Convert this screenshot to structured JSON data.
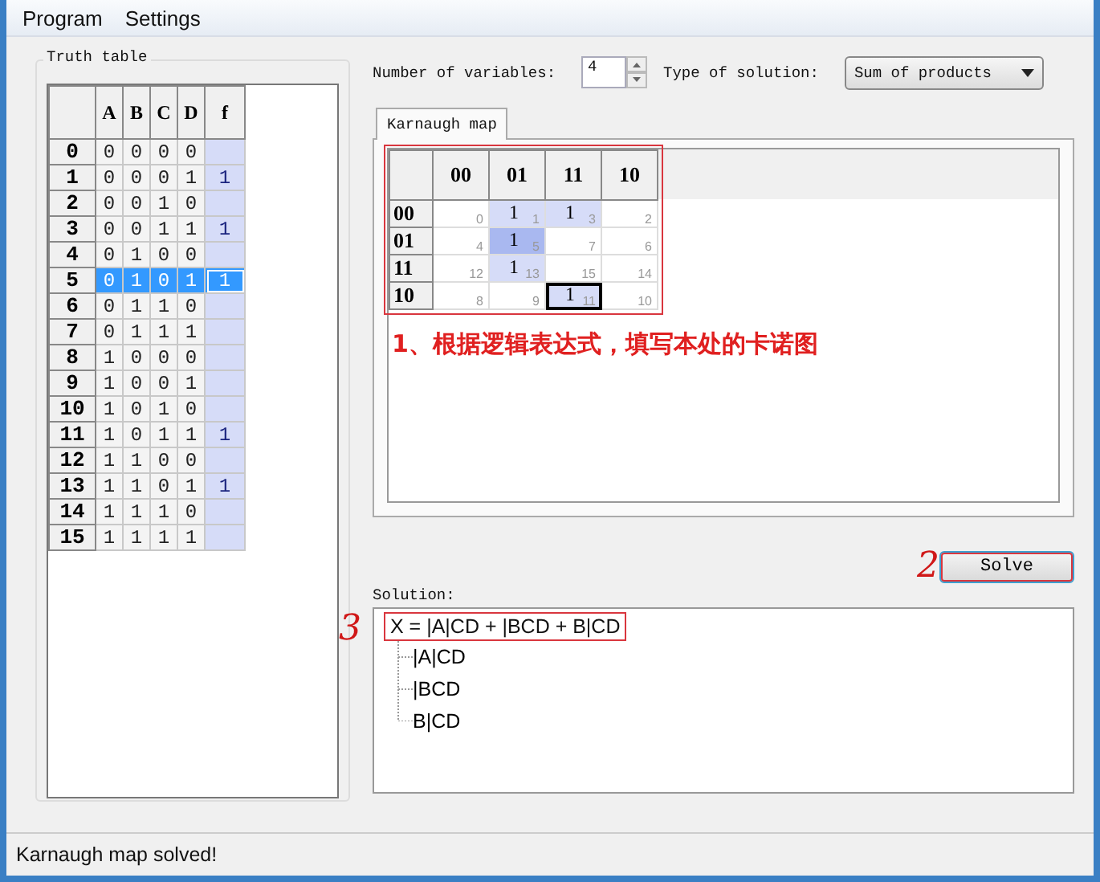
{
  "menu": [
    "Program",
    "Settings"
  ],
  "truth_table": {
    "title": "Truth table",
    "columns": [
      "A",
      "B",
      "C",
      "D",
      "f"
    ],
    "rows": [
      {
        "index": "0",
        "bits": [
          "0",
          "0",
          "0",
          "0"
        ],
        "selected": false
      },
      {
        "index": "1",
        "bits": [
          "0",
          "0",
          "0",
          "1"
        ],
        "f": "1",
        "selected": false
      },
      {
        "index": "2",
        "bits": [
          "0",
          "0",
          "1",
          "0"
        ],
        "selected": false
      },
      {
        "index": "3",
        "bits": [
          "0",
          "0",
          "1",
          "1"
        ],
        "f": "1",
        "selected": false
      },
      {
        "index": "4",
        "bits": [
          "0",
          "1",
          "0",
          "0"
        ],
        "selected": false
      },
      {
        "index": "5",
        "bits": [
          "0",
          "1",
          "0",
          "1"
        ],
        "f": "1",
        "selected": true
      },
      {
        "index": "6",
        "bits": [
          "0",
          "1",
          "1",
          "0"
        ],
        "selected": false
      },
      {
        "index": "7",
        "bits": [
          "0",
          "1",
          "1",
          "1"
        ],
        "selected": false
      },
      {
        "index": "8",
        "bits": [
          "1",
          "0",
          "0",
          "0"
        ],
        "selected": false
      },
      {
        "index": "9",
        "bits": [
          "1",
          "0",
          "0",
          "1"
        ],
        "selected": false
      },
      {
        "index": "10",
        "bits": [
          "1",
          "0",
          "1",
          "0"
        ],
        "selected": false
      },
      {
        "index": "11",
        "bits": [
          "1",
          "0",
          "1",
          "1"
        ],
        "f": "1",
        "selected": false
      },
      {
        "index": "12",
        "bits": [
          "1",
          "1",
          "0",
          "0"
        ],
        "selected": false
      },
      {
        "index": "13",
        "bits": [
          "1",
          "1",
          "0",
          "1"
        ],
        "f": "1",
        "selected": false
      },
      {
        "index": "14",
        "bits": [
          "1",
          "1",
          "1",
          "0"
        ],
        "selected": false
      },
      {
        "index": "15",
        "bits": [
          "1",
          "1",
          "1",
          "1"
        ],
        "selected": false
      }
    ]
  },
  "variables": {
    "label": "Number of variables:",
    "value": "4"
  },
  "solution_type": {
    "label": "Type of solution:",
    "value": "Sum of products"
  },
  "tabs": [
    {
      "label": "Karnaugh map",
      "selected": true
    }
  ],
  "kmap": {
    "columns": [
      "00",
      "01",
      "11",
      "10"
    ],
    "rows": [
      {
        "label": "00",
        "cells": [
          {
            "index": "0",
            "grouped": false,
            "overlap": false,
            "focused": false
          },
          {
            "value": "1",
            "index": "1",
            "grouped": true,
            "overlap": false,
            "focused": false
          },
          {
            "value": "1",
            "index": "3",
            "grouped": true,
            "overlap": false,
            "focused": false
          },
          {
            "index": "2",
            "grouped": false,
            "overlap": false,
            "focused": false
          }
        ]
      },
      {
        "label": "01",
        "cells": [
          {
            "index": "4",
            "grouped": false,
            "overlap": false,
            "focused": false
          },
          {
            "value": "1",
            "index": "5",
            "grouped": true,
            "overlap": true,
            "focused": false
          },
          {
            "index": "7",
            "grouped": false,
            "overlap": false,
            "focused": false
          },
          {
            "index": "6",
            "grouped": false,
            "overlap": false,
            "focused": false
          }
        ]
      },
      {
        "label": "11",
        "cells": [
          {
            "index": "12",
            "grouped": false,
            "overlap": false,
            "focused": false
          },
          {
            "value": "1",
            "index": "13",
            "grouped": true,
            "overlap": false,
            "focused": false
          },
          {
            "index": "15",
            "grouped": false,
            "overlap": false,
            "focused": false
          },
          {
            "index": "14",
            "grouped": false,
            "overlap": false,
            "focused": false
          }
        ]
      },
      {
        "label": "10",
        "cells": [
          {
            "index": "8",
            "grouped": false,
            "overlap": false,
            "focused": false
          },
          {
            "index": "9",
            "grouped": false,
            "overlap": false,
            "focused": false
          },
          {
            "value": "1",
            "index": "11",
            "grouped": true,
            "overlap": false,
            "focused": true
          },
          {
            "index": "10",
            "grouped": false,
            "overlap": false,
            "focused": false
          }
        ]
      }
    ]
  },
  "annotations": [
    {
      "text": "1、根据逻辑表达式，填写本处的卡诺图"
    },
    {
      "text": "2"
    },
    {
      "text": "3"
    }
  ],
  "solve_button": "Solve",
  "solution": {
    "label": "Solution:",
    "expression": "X = |A|CD + |BCD + B|CD",
    "terms": [
      "|A|CD",
      "|BCD",
      "B|CD"
    ]
  },
  "status_bar": "Karnaugh map solved!"
}
